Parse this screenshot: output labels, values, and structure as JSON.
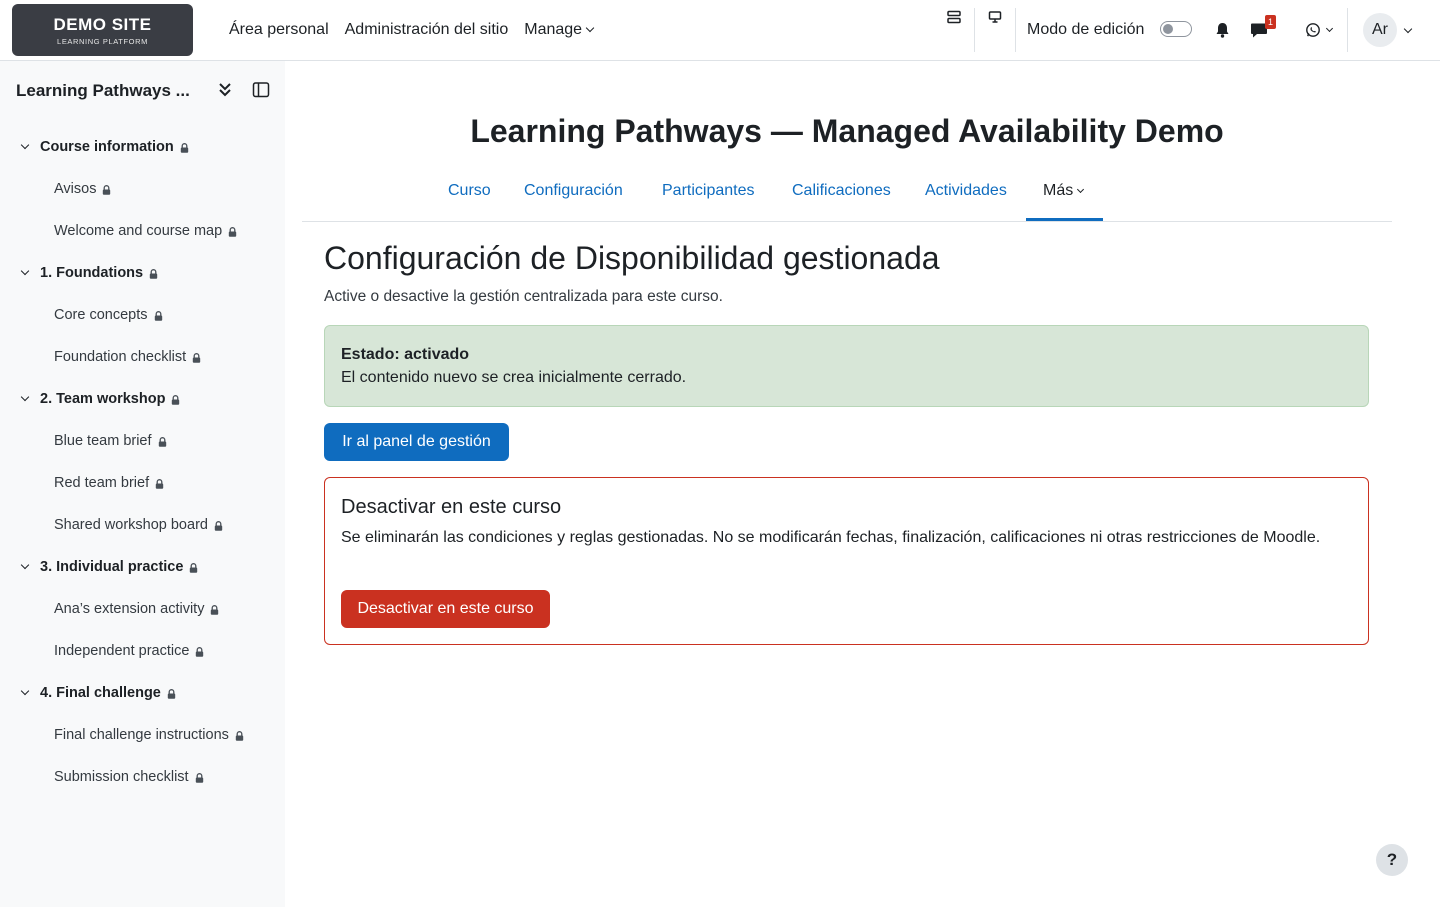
{
  "logo": {
    "title": "DEMO SITE",
    "subtitle": "LEARNING PLATFORM"
  },
  "primary_nav": [
    {
      "label": "Área personal"
    },
    {
      "label": "Administración del sitio"
    },
    {
      "label": "Manage"
    }
  ],
  "header": {
    "edit_mode_label": "Modo de edición",
    "notification_count": "1",
    "avatar_initials": "Ar"
  },
  "drawer": {
    "title": "Learning Pathways ...",
    "sections": [
      {
        "label": "Course information",
        "activities": [
          "Avisos",
          "Welcome and course map"
        ]
      },
      {
        "label": "1. Foundations",
        "activities": [
          "Core concepts",
          "Foundation checklist"
        ]
      },
      {
        "label": "2. Team workshop",
        "activities": [
          "Blue team brief",
          "Red team brief",
          "Shared workshop board"
        ]
      },
      {
        "label": "3. Individual practice",
        "activities": [
          "Ana’s extension activity",
          "Independent practice"
        ]
      },
      {
        "label": "4. Final challenge",
        "activities": [
          "Final challenge instructions",
          "Submission checklist"
        ]
      }
    ]
  },
  "course": {
    "title": "Learning Pathways — Managed Availability Demo",
    "tabs": [
      {
        "label": "Curso"
      },
      {
        "label": "Configuración"
      },
      {
        "label": "Participantes"
      },
      {
        "label": "Calificaciones"
      },
      {
        "label": "Actividades"
      },
      {
        "label": "Más"
      }
    ]
  },
  "page": {
    "heading": "Configuración de Disponibilidad gestionada",
    "description": "Active o desactive la gestión centralizada para este curso.",
    "status_title": "Estado: activado",
    "status_text": "El contenido nuevo se crea inicialmente cerrado.",
    "panel_button": "Ir al panel de gestión",
    "disable_title": "Desactivar en este curso",
    "disable_text": "Se eliminarán las condiciones y reglas gestionadas. No se modificarán fechas, finalización, calificaciones ni otras restricciones de Moodle.",
    "disable_button": "Desactivar en este curso"
  },
  "help": {
    "label": "?"
  },
  "colors": {
    "brand_blue": "#0f6cbf",
    "danger_red": "#ca3120",
    "success_bg": "#d7e6d7",
    "logo_bg": "#3a3d44"
  }
}
